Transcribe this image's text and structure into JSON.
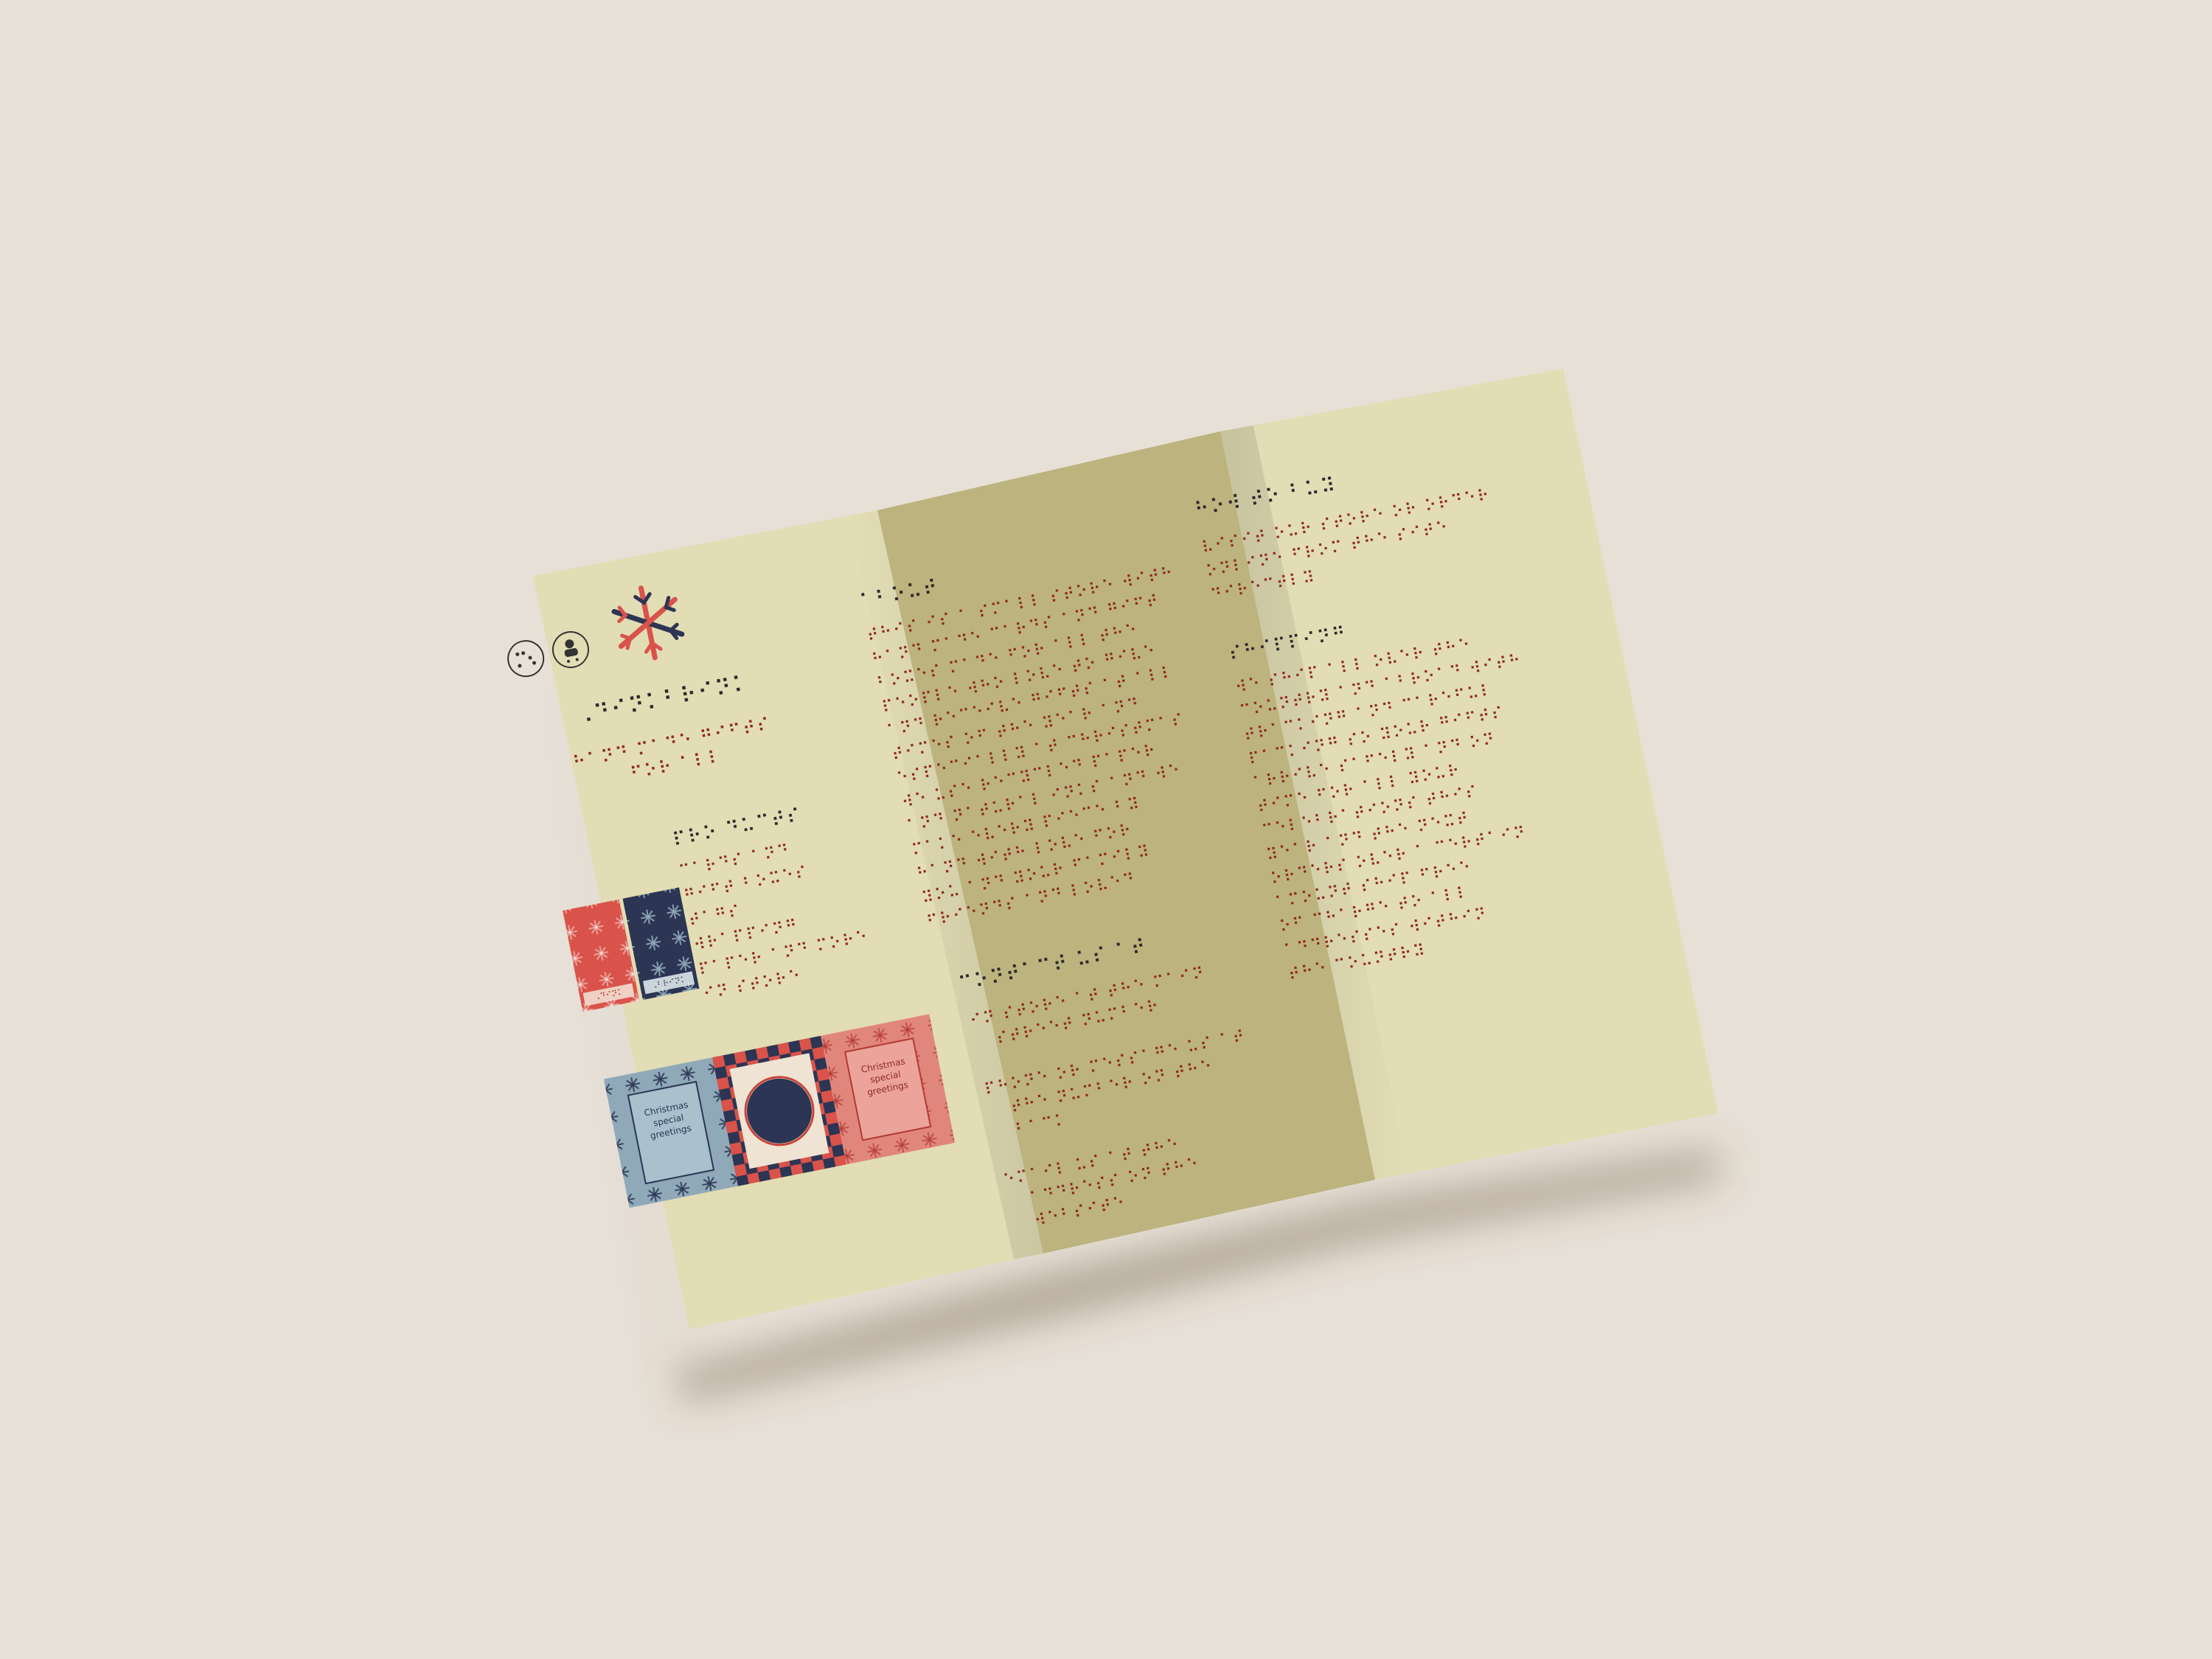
{
  "colors": {
    "background": "#e7e0d6",
    "panel_light": "#e2ddb4",
    "panel_middle": "#bdb37e",
    "braille_dark": "#2b2b2b",
    "braille_red": "#8f2a22",
    "navy": "#2c3553",
    "red": "#d9534a",
    "blue": "#8fa9b8",
    "salmon": "#e1867c"
  },
  "icons": {
    "left_circle_icon": "braille-circle-icon",
    "right_circle_icon": "person-icon",
    "logo": "snowflake-icon"
  },
  "brochure": {
    "left_panel": {
      "title_braille": "⠠⠙⠊⠝⠅⠃⠗⠊⠝⠅",
      "subtitle_braille": [
        "⠓⠁⠝⠙ ⠍⠁⠙⠑ ⠛⠊⠋⠞⠎",
        "⠋⠕⠗ ⠁⠇⠇"
      ],
      "section_heading_braille": "⠏⠗⠕ ⠙⠥⠉⠞⠎",
      "product_lines_braille": [
        "⠉⠁⠗⠙⠎ ⠁⠝⠙",
        "⠛⠊⠋⠞ ⠃⠕⠭⠑⠎",
        "⠞⠁⠛⠎",
        "⠺⠗⠁⠏⠏⠊⠝⠛",
        "⠏⠁⠏⠑⠗ ⠁⠝⠙ ⠍⠕⠗⠑",
        "⠊⠝ ⠎⠞⠕⠗⠑"
      ],
      "tag_left_label": "⠠⠙⠊⠝⠅",
      "tag_right_label": "⠠⠃⠗⠊⠝⠅",
      "card_text_lines": [
        "Christmas",
        "special",
        "greetings"
      ]
    },
    "middle_panel": {
      "heading_braille": "⠁⠃⠕⠥⠞",
      "paragraph_braille": [
        "⠞⠓⠊⠎ ⠊⠎ ⠁ ⠎⠍⠁⠇⠇ ⠎⠞⠕⠗⠑ ⠺⠊⠞⠓",
        "⠓⠁⠝⠙ ⠍⠁⠙⠑ ⠉⠁⠗⠙⠎ ⠁⠝⠙ ⠛⠊⠋⠞",
        "⠃⠕⠭⠑⠎ ⠍⠁⠙⠑ ⠋⠕⠗ ⠁⠇⠇ ⠞⠓⠑",
        "⠏⠑⠕⠏⠇⠑ ⠺⠓⠕ ⠇⠕⠧⠑ ⠞⠕ ⠛⠊⠧⠑",
        "⠁⠝⠙ ⠗⠑⠉⠑⠊⠧⠑ ⠛⠊⠋⠞⠎ ⠁⠞ ⠁⠇⠇",
        "⠞⠊⠍⠑⠎ ⠕⠋ ⠞⠓⠑ ⠽⠑⠁⠗ ⠁⠝⠙",
        "⠑⠎⠏⠑⠉⠊⠁⠇⠇⠽ ⠁⠞ ⠉⠓⠗⠊⠎⠞⠍⠁⠎",
        "⠺⠑ ⠥⠎⠑ ⠗⠑⠉⠽⠉⠇⠑⠙ ⠏⠁⠏⠑⠗",
        "⠁⠝⠙ ⠝⠁⠞⠥⠗⠁⠇ ⠊⠝⠅⠎ ⠁⠝⠙ ⠺⠑",
        "⠍⠁⠅⠑ ⠑⠧⠑⠗⠽ ⠏⠊⠑⠉⠑ ⠃⠽",
        "⠓⠁⠝⠙ ⠺⠊⠞⠓ ⠇⠕⠧⠑ ⠋⠕⠗",
        "⠽⠕⠥ ⠁⠝⠙ ⠽⠕⠥⠗ ⠋⠁⠍⠊⠇⠽",
        "⠋⠗⠊⠑⠝⠙⠎ ⠁⠝⠙ ⠇⠕⠧⠑⠙"
      ],
      "contact_heading_braille": "⠉⠕⠝⠞⠁⠉⠞ ⠥⠎ ⠁⠞",
      "contact_items_braille": [
        [
          "⠊⠝ ⠎⠞⠕⠗⠑ ⠁⠞ ⠞⠓⠑ ⠍⠁⠊⠝",
          "⠎⠞⠗⠑⠑⠞ ⠝⠥⠍⠃⠑⠗"
        ],
        [
          "⠏⠓⠕⠝⠑ ⠕⠗ ⠍⠑⠎⠎⠁⠛⠑ ⠥⠎ ⠁⠞",
          "⠞⠓⠑ ⠝⠥⠍⠃⠑⠗ ⠕⠝ ⠞⠓⠑",
          "⠃⠁⠉⠅"
        ],
        [
          "⠑⠍⠁⠊⠇ ⠥⠎ ⠁⠞ ⠞⠓⠑",
          "⠁⠙⠙⠗⠑⠎⠎ ⠕⠝ ⠞⠓⠑",
          "⠺⠑⠃⠎⠊⠞⠑"
        ]
      ]
    },
    "right_panel": {
      "heading_braille": "⠓⠕⠺ ⠞⠕ ⠃⠥⠽",
      "intro_braille": [
        "⠧⠊⠎⠊⠞ ⠕⠥⠗ ⠎⠞⠕⠗⠑ ⠕⠗ ⠕⠗⠙⠑⠗",
        "⠕⠝⠇⠊⠝⠑ ⠋⠗⠕⠍ ⠞⠓⠑ ⠎⠊⠞⠑",
        "⠙⠊⠗⠑⠉⠞⠇⠽"
      ],
      "subheading_braille": "⠎⠓⠊⠏⠏⠊⠝⠛",
      "paragraph_braille": [
        "⠺⠑ ⠎⠓⠊⠏ ⠁⠇⠇ ⠕⠧⠑⠗ ⠞⠓⠑",
        "⠉⠕⠥⠝⠞⠗⠽ ⠁⠝⠙ ⠁⠃⠗⠕⠁⠙ ⠺⠊⠞⠓",
        "⠞⠗⠁⠉⠅⠊⠝⠛ ⠁⠝⠙ ⠉⠁⠗⠑⠋⠥⠇",
        "⠏⠁⠉⠅⠊⠝⠛ ⠎⠕ ⠽⠕⠥⠗ ⠛⠊⠋⠞⠎",
        "⠁⠗⠗⠊⠧⠑ ⠎⠁⠋⠑⠇⠽ ⠁⠝⠙ ⠕⠝",
        "⠞⠊⠍⠑ ⠋⠕⠗ ⠁⠇⠇ ⠽⠕⠥⠗",
        "⠉⠑⠇⠑⠃⠗⠁⠞⠊⠕⠝⠎ ⠞⠓⠊⠎",
        "⠽⠑⠁⠗ ⠁⠝⠙ ⠞⠓⠑ ⠝⠑⠭⠞",
        "⠕⠗⠙⠑⠗⠎ ⠕⠧⠑⠗ ⠁ ⠉⠑⠗⠞⠁⠊⠝",
        "⠁⠍⠕⠥⠝⠞ ⠎⠓⠊⠏ ⠋⠗⠑⠑",
        "⠕⠋ ⠉⠓⠁⠗⠛⠑ ⠞⠕ ⠁⠇⠇",
        "⠁⠙⠙⠗⠑⠎⠎⠑⠎ ⠺⠊⠞⠓⠊⠝",
        "⠞⠓⠑ ⠉⠕⠥⠝⠞⠗⠽"
      ]
    }
  }
}
